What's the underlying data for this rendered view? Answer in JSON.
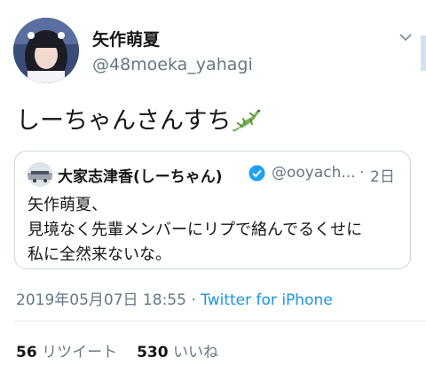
{
  "tweet": {
    "display_name": "矢作萌夏",
    "screen_name": "@48moeka_yahagi",
    "text": "しーちゃんさんすち",
    "emoji": "lizard-emoji",
    "caret_icon": "chevron-down-icon"
  },
  "quote": {
    "display_name": "大家志津香(しーちゃん)",
    "verified_icon": "verified-badge-icon",
    "screen_name": "@ooyach...",
    "separator": "·",
    "time": "2日",
    "lines": [
      "矢作萌夏、",
      "見境なく先輩メンバーにリプで絡んでるくせに",
      "私に全然来ないな。"
    ]
  },
  "meta": {
    "timestamp": "2019年05月07日 18:55",
    "separator": " · ",
    "source": "Twitter for iPhone"
  },
  "stats": {
    "retweets_count": "56",
    "retweets_label": "リツイート",
    "likes_count": "530",
    "likes_label": "いいね"
  },
  "colors": {
    "text": "#14171a",
    "secondary": "#657786",
    "link": "#1b95e0",
    "verified": "#1da1f2",
    "border": "#ccd6dd"
  }
}
